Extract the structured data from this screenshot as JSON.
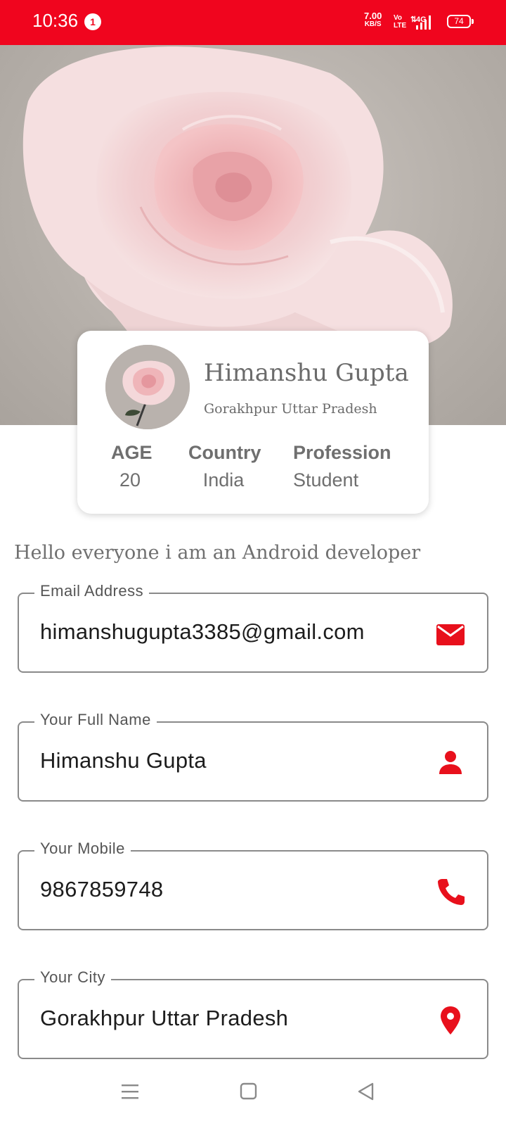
{
  "status_bar": {
    "time": "10:36",
    "notification_count": "1",
    "net_speed": "7.00",
    "net_speed_unit": "KB/S",
    "volte_top": "Vo",
    "volte_bottom": "LTE",
    "network": "4G",
    "battery": "74",
    "background_color": "#f0051e"
  },
  "profile": {
    "name": "Himanshu Gupta",
    "location": "Gorakhpur Uttar Pradesh",
    "stats": [
      {
        "label": "AGE",
        "value": "20"
      },
      {
        "label": "Country",
        "value": "India"
      },
      {
        "label": "Profession",
        "value": "Student"
      }
    ]
  },
  "bio": "Hello everyone i am an Android developer",
  "fields": [
    {
      "label": "Email Address",
      "value": "himanshugupta3385@gmail.com",
      "icon": "email-icon"
    },
    {
      "label": "Your Full Name",
      "value": "Himanshu Gupta",
      "icon": "person-icon"
    },
    {
      "label": "Your Mobile",
      "value": "9867859748",
      "icon": "phone-icon"
    },
    {
      "label": "Your City",
      "value": "Gorakhpur Uttar Pradesh",
      "icon": "location-pin-icon"
    }
  ],
  "accent_color": "#e8101c",
  "nav_bar": {
    "icons": [
      "menu-icon",
      "home-square-icon",
      "back-triangle-icon"
    ]
  }
}
